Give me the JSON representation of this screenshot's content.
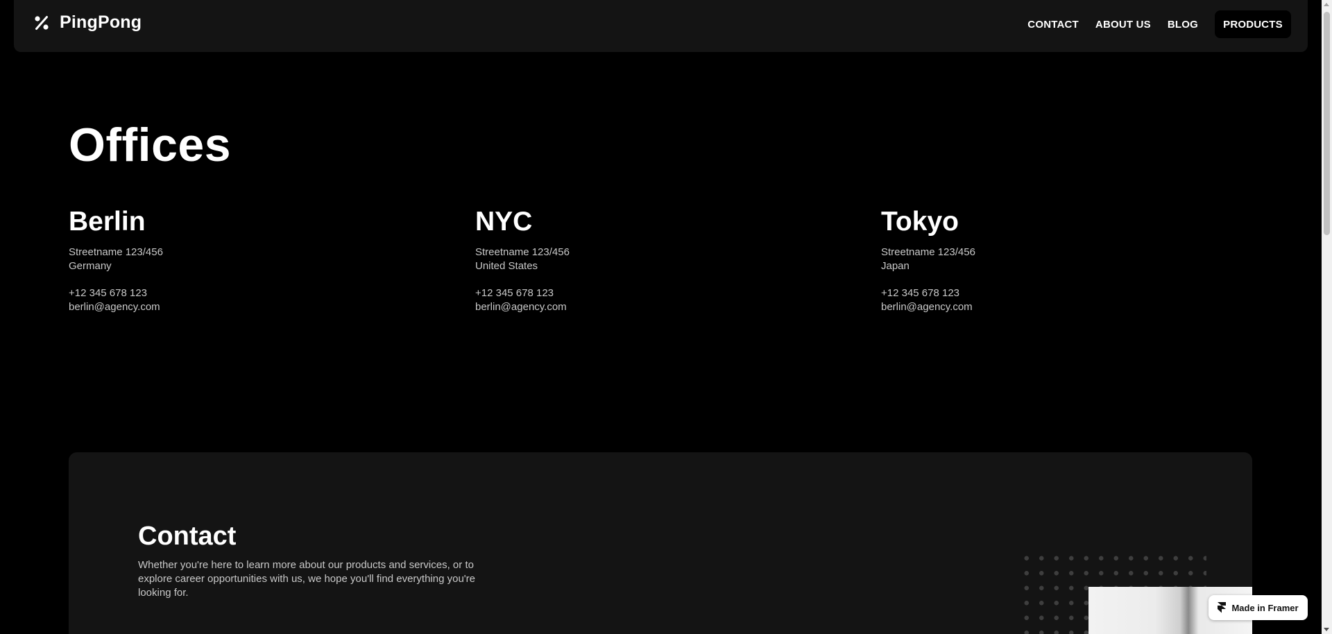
{
  "header": {
    "brand": "PingPong",
    "nav": {
      "contact": "CONTACT",
      "about": "ABOUT US",
      "blog": "BLOG",
      "products": "PRODUCTS"
    }
  },
  "offices": {
    "title": "Offices",
    "items": [
      {
        "city": "Berlin",
        "street": "Streetname 123/456",
        "country": "Germany",
        "phone": "+12 345 678 123",
        "email": "berlin@agency.com"
      },
      {
        "city": "NYC",
        "street": "Streetname 123/456",
        "country": "United States",
        "phone": "+12 345 678 123",
        "email": "berlin@agency.com"
      },
      {
        "city": "Tokyo",
        "street": "Streetname 123/456",
        "country": "Japan",
        "phone": "+12 345 678 123",
        "email": "berlin@agency.com"
      }
    ]
  },
  "contact": {
    "title": "Contact",
    "text": "Whether you're here to learn more about our products and services, or to explore career opportunities with us, we hope you'll find everything you're looking for."
  },
  "badge": {
    "label": "Made in Framer"
  },
  "icons": {
    "logo": "percent-icon",
    "badge": "framer-icon"
  },
  "colors": {
    "background": "#000000",
    "surface": "#141414",
    "text": "#ffffff",
    "muted_text": "#c9c9c9"
  }
}
